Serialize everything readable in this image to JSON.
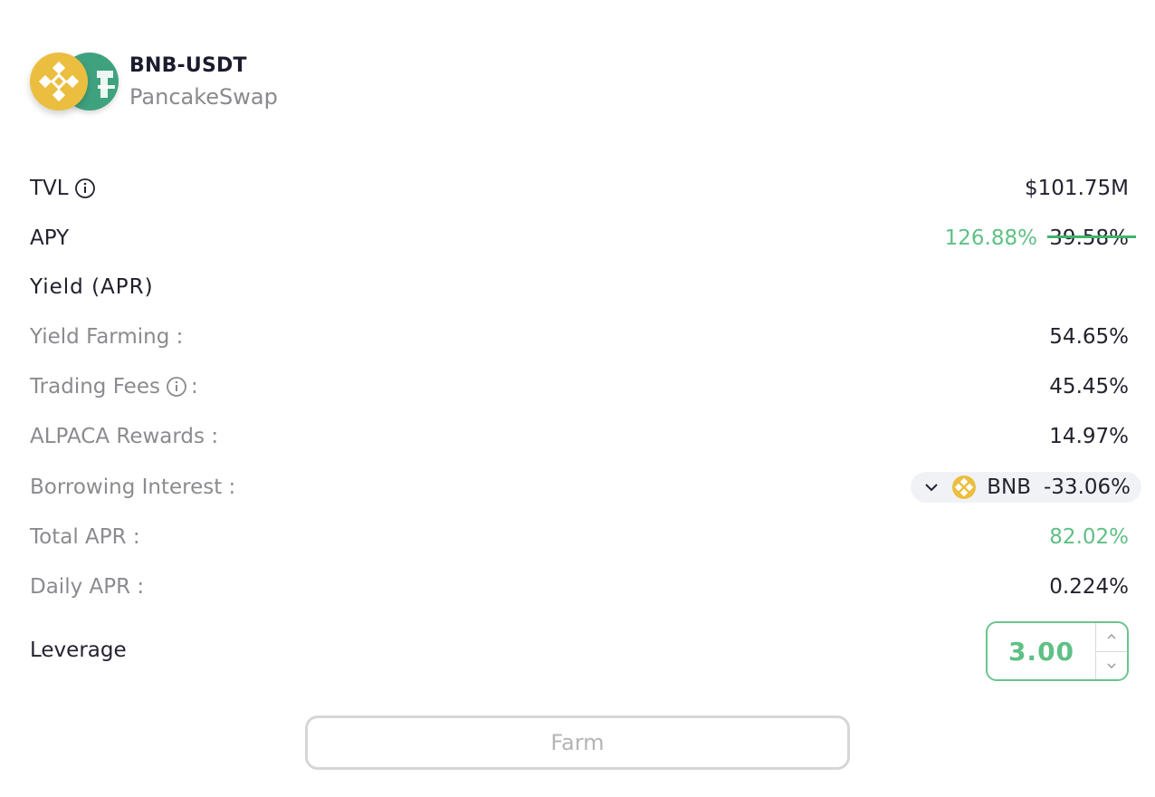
{
  "pool": {
    "pair": "BNB-USDT",
    "dex": "PancakeSwap",
    "icons": [
      "bnb-token-icon",
      "usdt-token-icon"
    ]
  },
  "tvl": {
    "label": "TVL",
    "value": "$101.75M"
  },
  "apy": {
    "label": "APY",
    "new_value": "126.88%",
    "old_value": "39.58%"
  },
  "yield": {
    "title": "Yield (APR)",
    "rows": [
      {
        "label": "Yield Farming :",
        "value": "54.65%"
      },
      {
        "label": "Trading Fees",
        "suffix": ":",
        "value": "45.45%"
      },
      {
        "label": "ALPACA Rewards :",
        "value": "14.97%"
      },
      {
        "label": "Borrowing Interest :",
        "token": "BNB",
        "value": "-33.06%"
      },
      {
        "label": "Total APR :",
        "value": "82.02%"
      },
      {
        "label": "Daily APR :",
        "value": "0.224%"
      }
    ]
  },
  "leverage": {
    "label": "Leverage",
    "value": "3.00"
  },
  "actions": {
    "farm_label": "Farm"
  },
  "colors": {
    "accent_green": "#5fc085",
    "bnb_yellow": "#ecbe3f",
    "usdt_green": "#3fa27f",
    "muted_text": "#8b8b8f"
  }
}
